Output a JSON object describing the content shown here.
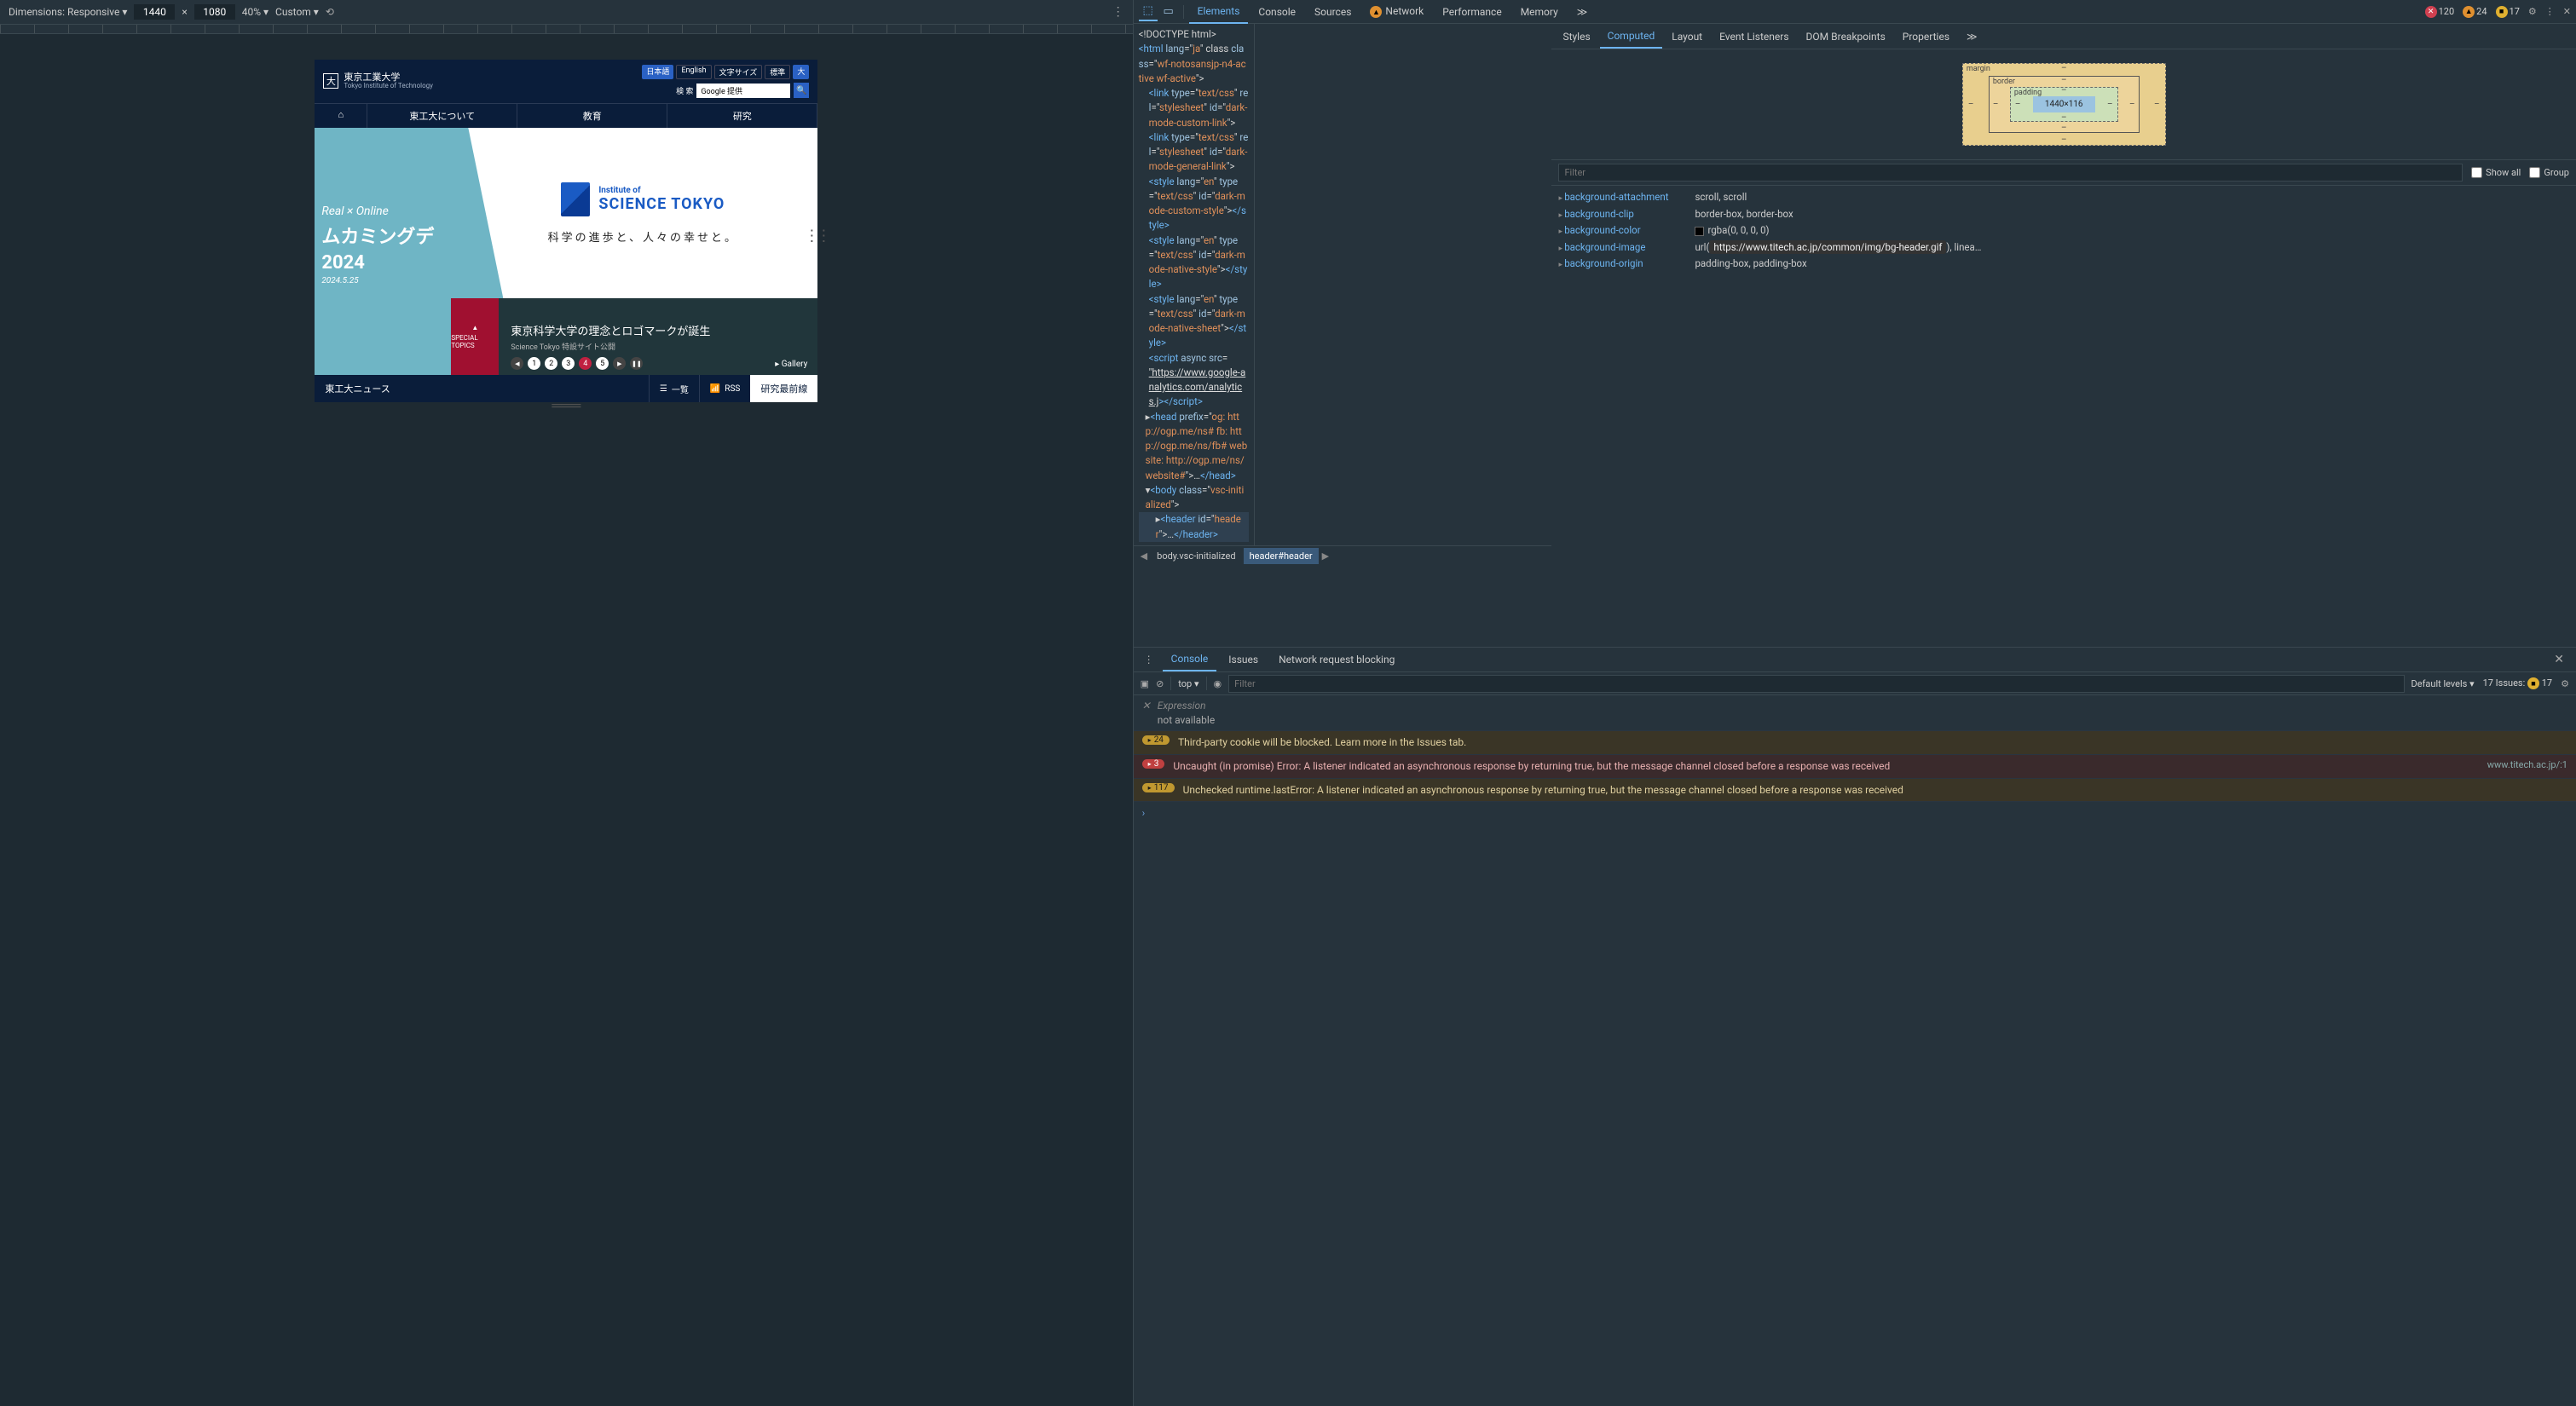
{
  "device_toolbar": {
    "dimensions_label": "Dimensions: Responsive ▾",
    "width": "1440",
    "times": "×",
    "height": "1080",
    "zoom": "40% ▾",
    "throttle": "Custom ▾"
  },
  "preview": {
    "logo_glyph": "大",
    "uni_name": "東京工業大学",
    "uni_sub": "Tokyo Institute of Technology",
    "lang": {
      "ja": "日本語",
      "en": "English",
      "size": "文字サイズ",
      "normal": "標準",
      "large": "大"
    },
    "search_label": "検 索",
    "search_placeholder": "Google 提供",
    "nav": {
      "home": "⌂",
      "about": "東工大について",
      "education": "教育",
      "research": "研究"
    },
    "hero": {
      "line1": "Real × Online",
      "line2": "ムカミングデ",
      "year": "2024",
      "date": "2024.5.25",
      "st_inst": "Institute of",
      "st_name": "SCIENCE TOKYO",
      "tagline": "科学の進歩と、人々の幸せと。"
    },
    "special": {
      "tag": "SPECIAL TOPICS",
      "line1": "東京科学大学の理念とロゴマークが誕生",
      "line2": "Science Tokyo 特設サイト公開",
      "gallery": "▸  Gallery",
      "slides": [
        "1",
        "2",
        "3",
        "4",
        "5"
      ]
    },
    "news": {
      "title": "東工大ニュース",
      "list": "一覧",
      "rss": "RSS",
      "more": "研究最前線"
    }
  },
  "tabs": {
    "elements": "Elements",
    "console": "Console",
    "sources": "Sources",
    "network": "Network",
    "performance": "Performance",
    "memory": "Memory",
    "more": "≫"
  },
  "counts": {
    "errors": "120",
    "warnings": "24",
    "issues": "17"
  },
  "dom": {
    "doctype": "<!DOCTYPE html>",
    "html_open": [
      "<",
      "html",
      " lang",
      "=\"",
      "ja",
      "\" class",
      "=\"",
      "wf-notosansjp-n4-active wf-active",
      "\">"
    ],
    "link1": [
      "<",
      "link",
      " type",
      "=\"",
      "text/css",
      "\" rel",
      "=\"",
      "stylesheet",
      "\" id",
      "=\"",
      "dark-mode-custom-link",
      "\">"
    ],
    "link2": [
      "<",
      "link",
      " type",
      "=\"",
      "text/css",
      "\" rel",
      "=\"",
      "stylesheet",
      "\" id",
      "=\"",
      "dark-mode-general-link",
      "\">"
    ],
    "style1": [
      "<",
      "style",
      " lang",
      "=\"",
      "en",
      "\" type",
      "=\"",
      "text/css",
      "\" id",
      "=\"",
      "dark-mode-custom-style",
      "\">",
      "</",
      "style",
      ">"
    ],
    "style2": [
      "<",
      "style",
      " lang",
      "=\"",
      "en",
      "\" type",
      "=\"",
      "text/css",
      "\" id",
      "=\"",
      "dark-mode-native-style",
      "\">",
      "</",
      "style",
      ">"
    ],
    "style3": [
      "<",
      "style",
      " lang",
      "=\"",
      "en",
      "\" type",
      "=\"",
      "text/css",
      "\" id",
      "=\"",
      "dark-mode-native-sheet",
      "\">",
      "</",
      "style",
      ">"
    ],
    "script_open": [
      "<",
      "script",
      " async src",
      "="
    ],
    "script_url": "\"https://www.google-analytics.com/analytics.j",
    "script_close": [
      "></",
      "script",
      ">"
    ],
    "head": [
      "▸<",
      "head",
      " prefix",
      "=\"",
      "og: http://ogp.me/ns# fb: http://ogp.me/ns/fb# website: http://ogp.me/ns/website#",
      "\">…</",
      "head",
      ">"
    ],
    "body": [
      "▾<",
      "body",
      " class",
      "=\"",
      "vsc-initialized",
      "\">"
    ],
    "header": [
      "  ▸<",
      "header",
      " id",
      "=\"",
      "header",
      "\">…</",
      "header",
      ">"
    ]
  },
  "crumbs": {
    "body": "body.vsc-initialized",
    "header": "header#header"
  },
  "side_tabs": {
    "styles": "Styles",
    "computed": "Computed",
    "layout": "Layout",
    "listeners": "Event Listeners",
    "dom_bp": "DOM Breakpoints",
    "props": "Properties",
    "more": "≫"
  },
  "box_model": {
    "margin": "margin",
    "border": "border",
    "padding": "padding",
    "content": "1440×116",
    "dash": "–"
  },
  "filter": {
    "placeholder": "Filter",
    "show_all": "Show all",
    "group": "Group"
  },
  "computed_props": [
    {
      "name": "background-attachment",
      "value": "scroll, scroll"
    },
    {
      "name": "background-clip",
      "value": "border-box, border-box"
    },
    {
      "name": "background-color",
      "value": "rgba(0, 0, 0, 0)",
      "swatch": true
    },
    {
      "name": "background-image",
      "value_pre": "url(",
      "value_tip": "https://www.titech.ac.jp/common/img/bg-header.gif",
      "value_post": "), linea…"
    },
    {
      "name": "background-origin",
      "value": "padding-box, padding-box"
    }
  ],
  "drawer": {
    "tabs": {
      "console": "Console",
      "issues": "Issues",
      "blocking": "Network request blocking"
    },
    "ctx": "top ▾",
    "filter_placeholder": "Filter",
    "levels": "Default levels ▾",
    "issues_label": "17 Issues:",
    "issues_count": "17",
    "expression_label": "Expression",
    "expression_value": "not available",
    "messages": [
      {
        "type": "warn",
        "count": "24",
        "text": "Third-party cookie will be blocked. Learn more in the Issues tab."
      },
      {
        "type": "err",
        "count": "3",
        "text": "Uncaught (in promise) Error: A listener indicated an asynchronous response by returning true, but the message channel closed before a response was received",
        "src": "www.titech.ac.jp/:1"
      },
      {
        "type": "warn",
        "count": "117",
        "text": "Unchecked runtime.lastError: A listener indicated an asynchronous response by returning true, but the message channel closed before a response was received"
      }
    ]
  }
}
